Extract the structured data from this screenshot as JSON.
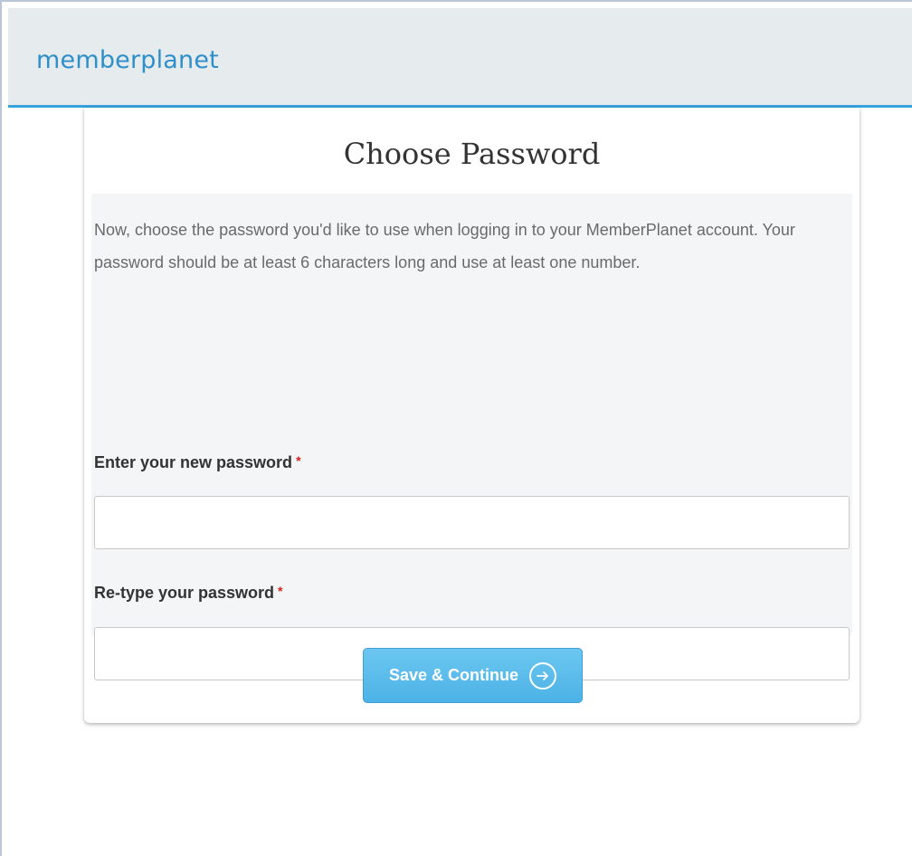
{
  "header": {
    "logo_text": "memberplanet"
  },
  "card": {
    "title": "Choose Password",
    "description": "Now, choose the password you'd like to use when logging in to your MemberPlanet account. Your password should be at least 6 characters long and use at least one number.",
    "new_password": {
      "label": "Enter your new password",
      "required_marker": "*",
      "value": ""
    },
    "retype_password": {
      "label": "Re-type your password",
      "required_marker": "*",
      "value": ""
    },
    "submit_label": "Save & Continue"
  },
  "colors": {
    "brand": "#2f8fc9",
    "header_bg": "#e6ebee",
    "header_border": "#39a3dc",
    "button": "#5bbbeb",
    "required": "#d62020"
  },
  "icons": {
    "submit_icon": "arrow-right-circle-icon"
  }
}
